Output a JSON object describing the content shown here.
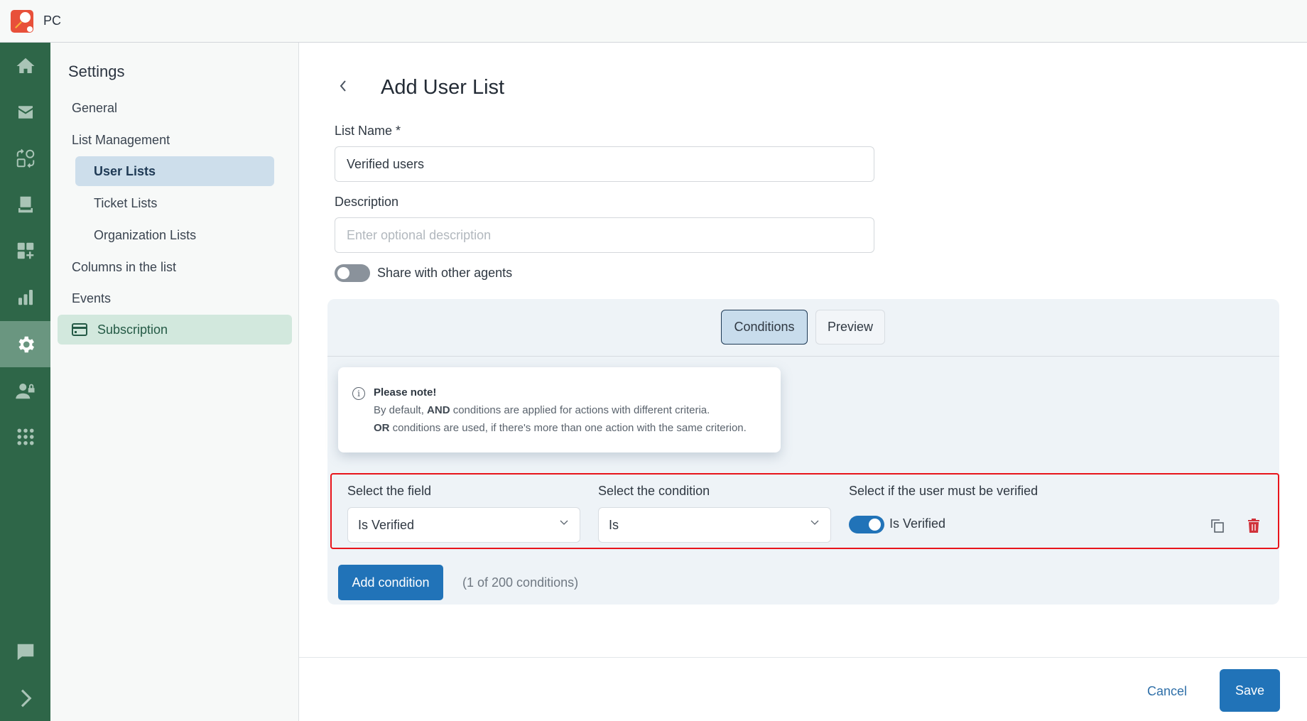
{
  "app": {
    "title": "PC",
    "logo": "app-logo"
  },
  "rail": {
    "items": [
      {
        "name": "home",
        "icon": "home-icon"
      },
      {
        "name": "inbox",
        "icon": "mail-icon"
      },
      {
        "name": "automations",
        "icon": "workflow-icon"
      },
      {
        "name": "knowledge-base",
        "icon": "book-icon"
      },
      {
        "name": "add-widgets",
        "icon": "grid-plus-icon"
      },
      {
        "name": "reports",
        "icon": "bar-chart-icon"
      },
      {
        "name": "settings",
        "icon": "gear-icon",
        "active": true
      },
      {
        "name": "user-permissions",
        "icon": "user-lock-icon"
      },
      {
        "name": "apps",
        "icon": "apps-grid-icon"
      },
      {
        "name": "chat",
        "icon": "chat-icon"
      },
      {
        "name": "expand",
        "icon": "chevron-right-icon"
      }
    ]
  },
  "sidebar": {
    "title": "Settings",
    "items": {
      "general": "General",
      "list_management": "List Management",
      "user_lists": "User Lists",
      "ticket_lists": "Ticket Lists",
      "organization_lists": "Organization Lists",
      "columns": "Columns in the list",
      "events": "Events",
      "subscription": "Subscription"
    },
    "active": "User Lists"
  },
  "main": {
    "title": "Add User List",
    "back_icon": "chevron-left-icon",
    "list_name_label": "List Name *",
    "list_name_value": "Verified users",
    "description_label": "Description",
    "description_placeholder": "Enter optional description",
    "share_label": "Share with other agents",
    "share_enabled": false,
    "tabs": [
      {
        "label": "Conditions",
        "active": true
      },
      {
        "label": "Preview",
        "active": false
      }
    ],
    "note": {
      "title": "Please note!",
      "line1_bold": "AND",
      "line1_pre": "By default, ",
      "line1_post": " conditions are applied for actions with different criteria.",
      "line2_bold": "OR",
      "line2_post": " conditions are used, if there's more than one action with the same criterion."
    },
    "condition": {
      "field_label": "Select the field",
      "field_value": "Is Verified",
      "condition_label": "Select the condition",
      "condition_value": "Is",
      "verified_label": "Select if the user must be verified",
      "verified_toggle_label": "Is Verified",
      "verified_enabled": true
    },
    "add_condition_label": "Add condition",
    "condition_count": "(1 of 200 conditions)",
    "cancel_label": "Cancel",
    "save_label": "Save"
  },
  "colors": {
    "rail": "#2e6648",
    "primary": "#2173b8",
    "danger": "#d0313a",
    "highlight_border": "#e8141b"
  }
}
